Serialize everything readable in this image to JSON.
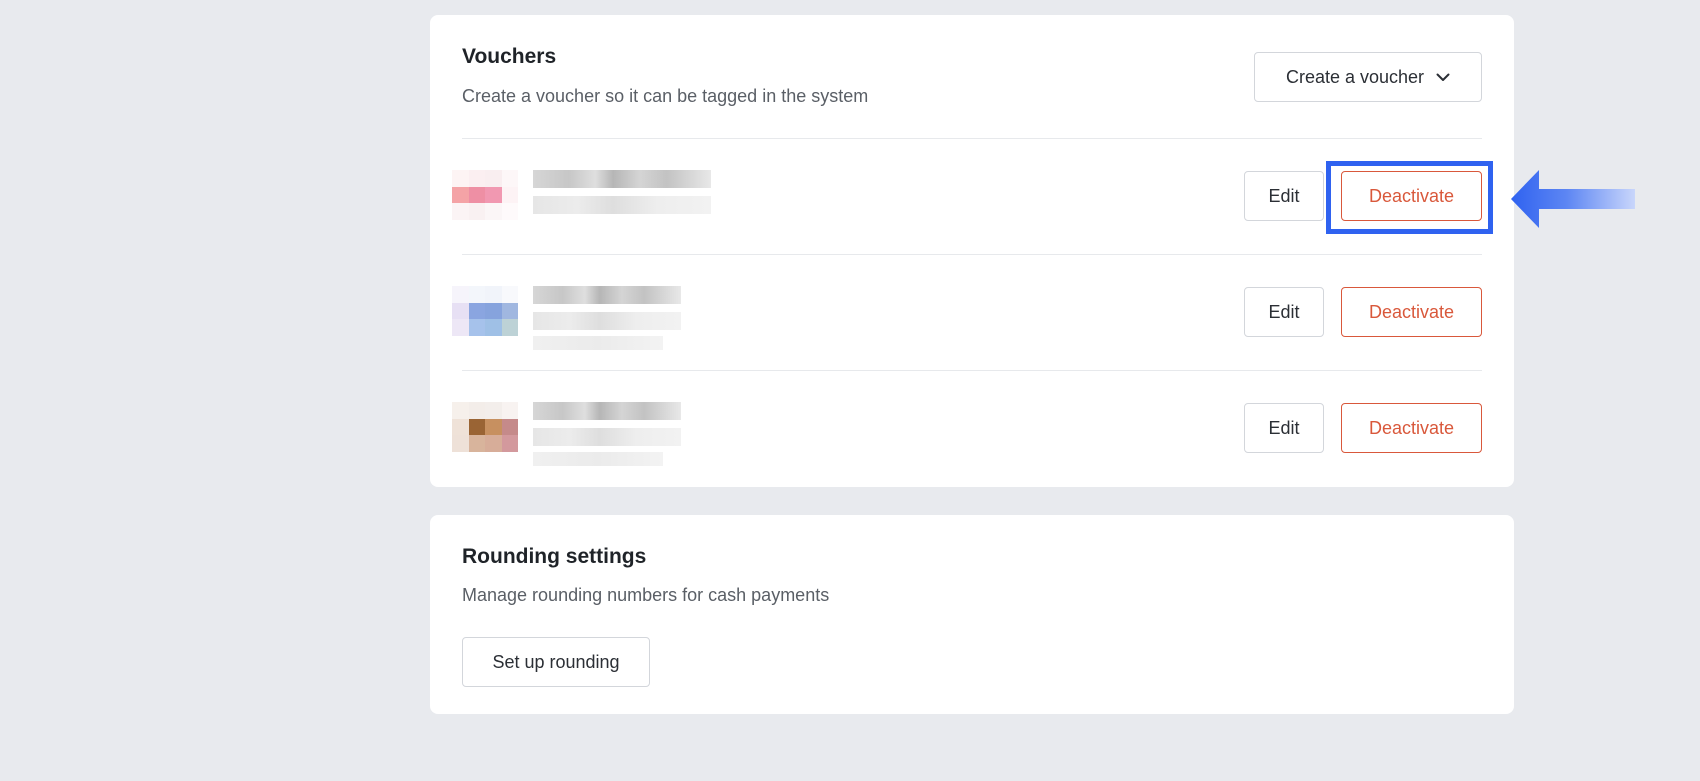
{
  "vouchers": {
    "title": "Vouchers",
    "description": "Create a voucher so it can be tagged in the system",
    "create_button_label": "Create a voucher",
    "items": [
      {
        "thumb_colors": [
          "#fdf4f4",
          "#fbeff1",
          "#f9eef0",
          "#fdf7f8",
          "#f4a3a6",
          "#ee8fa4",
          "#f198b1",
          "#fdf3f5",
          "#fbf4f5",
          "#f9f1f2",
          "#fbf6f7",
          "#fefafb"
        ],
        "edit_label": "Edit",
        "deactivate_label": "Deactivate"
      },
      {
        "thumb_colors": [
          "#f6f4fb",
          "#f3f6fb",
          "#f1f4fa",
          "#f8f9fc",
          "#e7e0f4",
          "#8aa5e0",
          "#86a3dd",
          "#a0b7e0",
          "#ede7f6",
          "#a6c2eb",
          "#9fc0e6",
          "#bdd2d6"
        ],
        "edit_label": "Edit",
        "deactivate_label": "Deactivate"
      },
      {
        "thumb_colors": [
          "#f6f0eb",
          "#f3ede9",
          "#f3eeeb",
          "#f8f3f1",
          "#efe2d8",
          "#9a6434",
          "#c79060",
          "#c58a8a",
          "#eee1d8",
          "#d8b49c",
          "#d7ad99",
          "#d3999d"
        ],
        "edit_label": "Edit",
        "deactivate_label": "Deactivate"
      }
    ]
  },
  "rounding": {
    "title": "Rounding settings",
    "description": "Manage rounding numbers for cash payments",
    "setup_button_label": "Set up rounding"
  },
  "colors": {
    "page_bg": "#e8eaee",
    "card_bg": "#ffffff",
    "danger": "#d9583b",
    "highlight": "#2f62f0"
  }
}
